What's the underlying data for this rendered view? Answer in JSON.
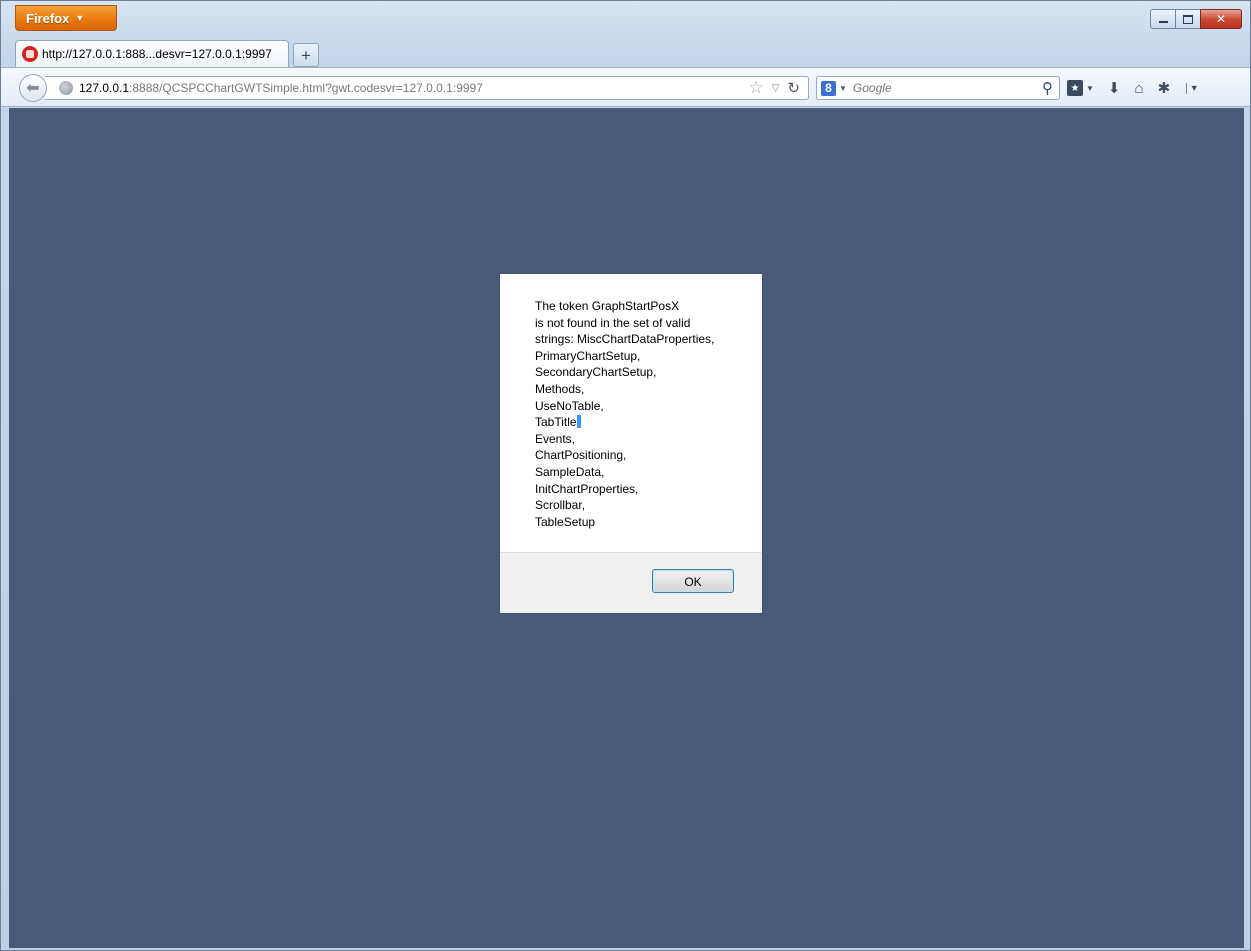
{
  "browser": {
    "app_button": "Firefox",
    "tab": {
      "title": "http://127.0.0.1:888...desvr=127.0.0.1:9997"
    },
    "newtab_label": "+",
    "url": {
      "host": "127.0.0.1",
      "rest": ":8888/QCSPCChartGWTSimple.html?gwt.codesvr=127.0.0.1:9997"
    },
    "search": {
      "engine_letter": "8",
      "placeholder": "Google"
    }
  },
  "colors": {
    "page_background": "#485a78",
    "app_button": "#e87b0d"
  },
  "dialog": {
    "message_lines": [
      "The token GraphStartPosX",
      "is not found in the set of valid",
      "strings: MiscChartDataProperties,",
      "PrimaryChartSetup,",
      "SecondaryChartSetup,",
      "Methods,",
      "UseNoTable,",
      "TabTitle",
      "Events,",
      "ChartPositioning,",
      "SampleData,",
      "InitChartProperties,",
      "Scrollbar,",
      "TableSetup"
    ],
    "ok_label": "OK"
  }
}
